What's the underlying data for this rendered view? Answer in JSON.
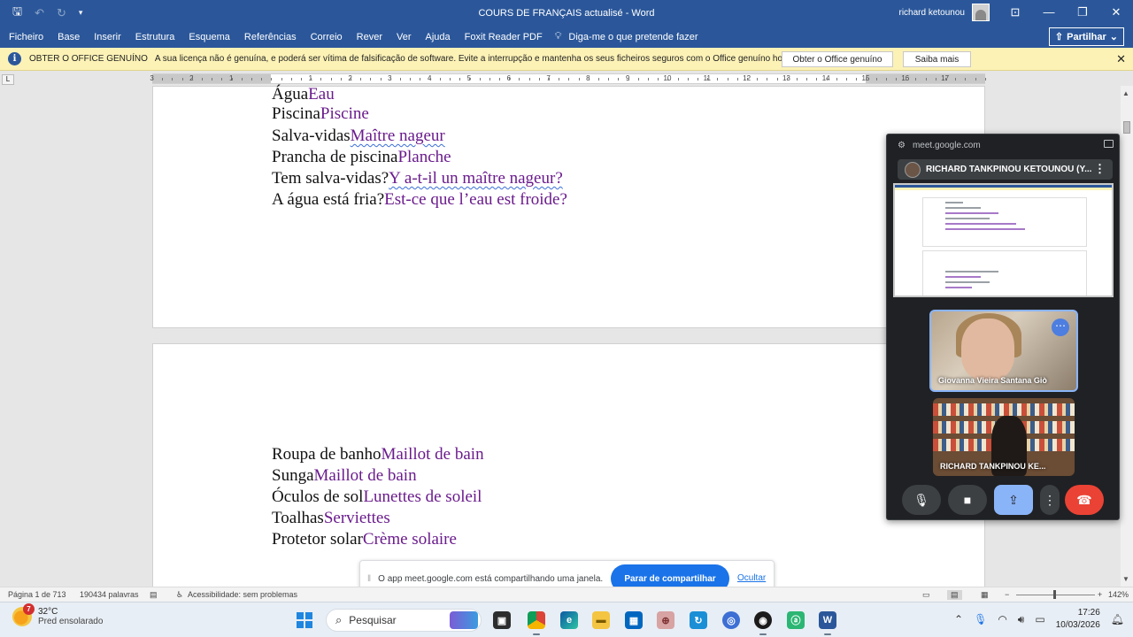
{
  "window": {
    "title": "COURS DE FRANÇAIS actualisé  -  Word",
    "user": "richard ketounou",
    "quick_access": [
      "save-icon",
      "undo-icon",
      "redo-icon",
      "customize-icon"
    ]
  },
  "ribbon": {
    "tabs": [
      "Ficheiro",
      "Base",
      "Inserir",
      "Estrutura",
      "Esquema",
      "Referências",
      "Correio",
      "Rever",
      "Ver",
      "Ajuda",
      "Foxit Reader PDF"
    ],
    "tell_me": "Diga-me o que pretende fazer",
    "share": "Partilhar"
  },
  "license_bar": {
    "title": "OBTER O OFFICE GENUÍNO",
    "message": "A sua licença não é genuína, e poderá ser vítima de falsificação de software. Evite a interrupção e mantenha os seus ficheiros seguros com o Office genuíno hoje.",
    "primary_button": "Obter o Office genuíno",
    "secondary_button": "Saiba mais"
  },
  "ruler": {
    "corner": "L",
    "numbers": [
      "3",
      "2",
      "1",
      "1",
      "2",
      "3",
      "4",
      "5",
      "6",
      "7",
      "8",
      "9",
      "10",
      "11",
      "12",
      "13",
      "14",
      "15",
      "16",
      "17"
    ]
  },
  "document": {
    "page1_lines": [
      {
        "pt": "Água",
        "fr": "Eau"
      },
      {
        "pt": "Piscina",
        "fr": "Piscine"
      },
      {
        "pt": "Salva-vidas",
        "fr": "Maître nageur"
      },
      {
        "pt": "Prancha de piscina",
        "fr": "Planche"
      },
      {
        "pt": "Tem salva-vidas?",
        "fr": "Y a-t-il un maître nageur?"
      },
      {
        "pt": "A água está fria?",
        "fr": "Est-ce que l’eau est froide?"
      }
    ],
    "page2_lines": [
      {
        "pt": "Roupa de banho",
        "fr": "Maillot de bain"
      },
      {
        "pt": "Sunga",
        "fr": "Maillot de bain"
      },
      {
        "pt": "Óculos de sol",
        "fr": "Lunettes de soleil"
      },
      {
        "pt": "Toalhas",
        "fr": "Serviettes"
      },
      {
        "pt": "Protetor solar",
        "fr": "Crème solaire"
      }
    ]
  },
  "meet": {
    "url": "meet.google.com",
    "presenter": "RICHARD TANKPINOU KETOUNOU (Y...",
    "participant1": "Giovanna Vieira Santana Giò",
    "participant2": "RICHARD TANKPINOU KE...",
    "controls": [
      "microphone-icon",
      "camera-icon",
      "present-icon",
      "more-icon",
      "hang-up-icon"
    ]
  },
  "share_notice": {
    "message": "O app meet.google.com está compartilhando uma janela.",
    "stop_button": "Parar de compartilhar",
    "hide_link": "Ocultar"
  },
  "status_bar": {
    "page": "Página 1 de 713",
    "words": "190434 palavras",
    "accessibility": "Acessibilidade: sem problemas",
    "zoom": "142%"
  },
  "taskbar": {
    "weather_temp": "32°C",
    "weather_desc": "Pred ensolarado",
    "weather_badge": "7",
    "search_placeholder": "Pesquisar",
    "time": "17:26",
    "date": "10/03/2026"
  }
}
